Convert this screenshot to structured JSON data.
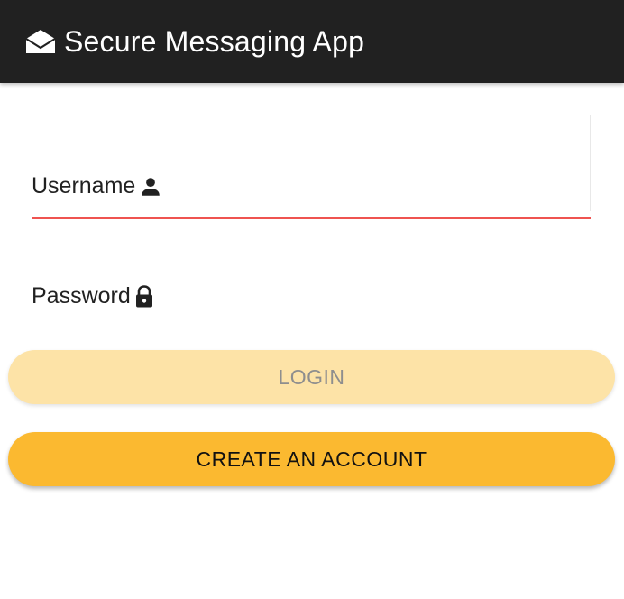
{
  "app_bar": {
    "title": "Secure Messaging App",
    "icon": "envelope-open-icon",
    "background_color": "#212121"
  },
  "form": {
    "username": {
      "label": "Username",
      "icon": "person-icon",
      "value": "",
      "underline_color": "#ef5350"
    },
    "password": {
      "label": "Password",
      "icon": "lock-icon",
      "value": ""
    }
  },
  "buttons": {
    "login_label": "LOGIN",
    "create_account_label": "CREATE AN ACCOUNT",
    "accent_color": "#fbb930"
  }
}
